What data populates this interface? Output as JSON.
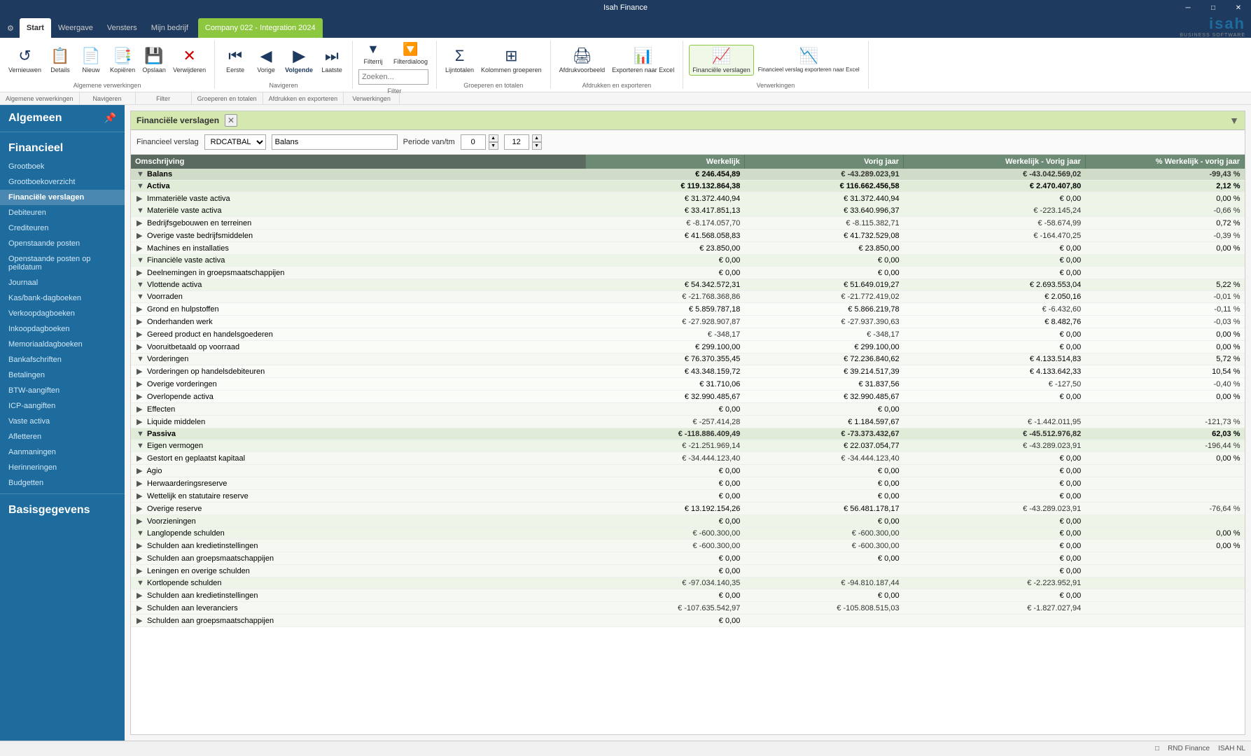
{
  "app": {
    "title": "Isah Finance",
    "window_controls": [
      "minimize",
      "maximize",
      "close"
    ]
  },
  "tabs": [
    {
      "label": "⚙",
      "id": "settings"
    },
    {
      "label": "Start",
      "id": "start",
      "active": true
    },
    {
      "label": "Weergave",
      "id": "weergave"
    },
    {
      "label": "Vensters",
      "id": "vensters"
    },
    {
      "label": "Mijn bedrijf",
      "id": "mijnbedrijf"
    },
    {
      "label": "Company 022 - Integration 2024",
      "id": "company",
      "company": true
    }
  ],
  "ribbon": {
    "groups": [
      {
        "label": "Algemene verwerkingen",
        "buttons": [
          {
            "label": "Vernieuwen",
            "icon": "↺"
          },
          {
            "label": "Details",
            "icon": "📋"
          },
          {
            "label": "Nieuw",
            "icon": "📄"
          },
          {
            "label": "Kopiëren",
            "icon": "📑"
          },
          {
            "label": "Opslaan",
            "icon": "💾"
          },
          {
            "label": "Verwijderen",
            "icon": "✕"
          }
        ]
      },
      {
        "label": "Navigeren",
        "buttons": [
          {
            "label": "Eerste",
            "icon": "⏮"
          },
          {
            "label": "Vorige",
            "icon": "◀"
          },
          {
            "label": "Volgende",
            "icon": "▶",
            "active": true
          },
          {
            "label": "Laatste",
            "icon": "⏭"
          }
        ]
      },
      {
        "label": "Filter",
        "buttons": [
          {
            "label": "Filterrij",
            "icon": "▼"
          },
          {
            "label": "Filterdialoog",
            "icon": "🔽"
          },
          {
            "label": "Zoeken...",
            "icon": "🔍",
            "search": true
          }
        ]
      },
      {
        "label": "Groeperen en totalen",
        "buttons": [
          {
            "label": "Lijntotalen",
            "icon": "Σ"
          },
          {
            "label": "Kolommen groeperen",
            "icon": "⊞"
          }
        ]
      },
      {
        "label": "Afdrukken en exporteren",
        "buttons": [
          {
            "label": "Afdrukvoorbeeld",
            "icon": "🖨"
          },
          {
            "label": "Exporteren naar Excel",
            "icon": "📊"
          }
        ]
      },
      {
        "label": "Verwerkingen",
        "buttons": [
          {
            "label": "Financiële verslagen",
            "icon": "📈",
            "active": true
          },
          {
            "label": "Financieel verslag exporteren naar Excel",
            "icon": "📉"
          }
        ]
      }
    ]
  },
  "sidebar": {
    "sections": [
      {
        "title": "Algemeen",
        "items": []
      },
      {
        "title": "Financieel",
        "items": [
          {
            "label": "Grootboek",
            "id": "grootboek"
          },
          {
            "label": "Grootboekoverzicht",
            "id": "grootboekoverzicht"
          },
          {
            "label": "Financiële verslagen",
            "id": "financiele-verslagen",
            "active": true
          },
          {
            "label": "Debiteuren",
            "id": "debiteuren"
          },
          {
            "label": "Crediteuren",
            "id": "crediteuren"
          },
          {
            "label": "Openstaande posten",
            "id": "openstaande-posten"
          },
          {
            "label": "Openstaande posten op peildatum",
            "id": "openstaande-posten-peildatum"
          },
          {
            "label": "Journaal",
            "id": "journaal"
          },
          {
            "label": "Kas/bank-dagboeken",
            "id": "kas-bank"
          },
          {
            "label": "Verkoopdagboeken",
            "id": "verkoop"
          },
          {
            "label": "Inkoopdagboeken",
            "id": "inkoop"
          },
          {
            "label": "Memoriaaldagboeken",
            "id": "memoriaal"
          },
          {
            "label": "Bankafschriften",
            "id": "bankafschriften"
          },
          {
            "label": "Betalingen",
            "id": "betalingen"
          },
          {
            "label": "BTW-aangiften",
            "id": "btw"
          },
          {
            "label": "ICP-aangiften",
            "id": "icp"
          },
          {
            "label": "Vaste activa",
            "id": "vaste-activa"
          },
          {
            "label": "Afletteren",
            "id": "afletteren"
          },
          {
            "label": "Aanmaningen",
            "id": "aanmaningen"
          },
          {
            "label": "Herinneringen",
            "id": "herinneringen"
          },
          {
            "label": "Budgetten",
            "id": "budgetten"
          }
        ]
      },
      {
        "title": "Basisgegevens",
        "items": []
      }
    ]
  },
  "report_panel": {
    "title": "Financiële verslagen",
    "toolbar": {
      "verslag_label": "Financieel verslag",
      "verslag_value": "RDCATBAL",
      "balans_value": "Balans",
      "periode_label": "Periode van/tm",
      "periode_from": "0",
      "periode_to": "12"
    },
    "table": {
      "columns": [
        "Omschrijving",
        "Werkelijk",
        "Vorig jaar",
        "Werkelijk - Vorig jaar",
        "% Werkelijk - vorig jaar"
      ],
      "rows": [
        {
          "level": 0,
          "indent": 0,
          "label": "Balans",
          "expand": true,
          "werkelijk": "€ 246.454,89",
          "vorig": "€ -43.289.023,91",
          "diff": "€ -43.042.569,02",
          "pct": "-99,43 %"
        },
        {
          "level": 1,
          "indent": 1,
          "label": "Activa",
          "expand": true,
          "werkelijk": "€ 119.132.864,38",
          "vorig": "€ 116.662.456,58",
          "diff": "€ 2.470.407,80",
          "pct": "2,12 %"
        },
        {
          "level": 2,
          "indent": 2,
          "label": "Immateriële vaste activa",
          "expand": false,
          "werkelijk": "€ 31.372.440,94",
          "vorig": "€ 31.372.440,94",
          "diff": "€ 0,00",
          "pct": "0,00 %"
        },
        {
          "level": 2,
          "indent": 2,
          "label": "Materiële vaste activa",
          "expand": true,
          "werkelijk": "€ 33.417.851,13",
          "vorig": "€ 33.640.996,37",
          "diff": "€ -223.145,24",
          "pct": "-0,66 %"
        },
        {
          "level": 3,
          "indent": 3,
          "label": "Bedrijfsgebouwen en terreinen",
          "expand": false,
          "werkelijk": "€ -8.174.057,70",
          "vorig": "€ -8.115.382,71",
          "diff": "€ -58.674,99",
          "pct": "0,72 %"
        },
        {
          "level": 3,
          "indent": 3,
          "label": "Overige vaste bedrijfsmiddelen",
          "expand": false,
          "werkelijk": "€ 41.568.058,83",
          "vorig": "€ 41.732.529,08",
          "diff": "€ -164.470,25",
          "pct": "-0,39 %"
        },
        {
          "level": 3,
          "indent": 3,
          "label": "Machines en installaties",
          "expand": false,
          "werkelijk": "€ 23.850,00",
          "vorig": "€ 23.850,00",
          "diff": "€ 0,00",
          "pct": "0,00 %"
        },
        {
          "level": 2,
          "indent": 2,
          "label": "Financiële vaste activa",
          "expand": true,
          "werkelijk": "€ 0,00",
          "vorig": "€ 0,00",
          "diff": "€ 0,00",
          "pct": ""
        },
        {
          "level": 3,
          "indent": 3,
          "label": "Deelnemingen in groepsmaatschappijen",
          "expand": false,
          "werkelijk": "€ 0,00",
          "vorig": "€ 0,00",
          "diff": "€ 0,00",
          "pct": ""
        },
        {
          "level": 2,
          "indent": 2,
          "label": "Vlottende activa",
          "expand": true,
          "werkelijk": "€ 54.342.572,31",
          "vorig": "€ 51.649.019,27",
          "diff": "€ 2.693.553,04",
          "pct": "5,22 %"
        },
        {
          "level": 3,
          "indent": 3,
          "label": "Voorraden",
          "expand": true,
          "werkelijk": "€ -21.768.368,86",
          "vorig": "€ -21.772.419,02",
          "diff": "€ 2.050,16",
          "pct": "-0,01 %"
        },
        {
          "level": 4,
          "indent": 4,
          "label": "Grond en hulpstoffen",
          "expand": false,
          "werkelijk": "€ 5.859.787,18",
          "vorig": "€ 5.866.219,78",
          "diff": "€ -6.432,60",
          "pct": "-0,11 %"
        },
        {
          "level": 4,
          "indent": 4,
          "label": "Onderhanden werk",
          "expand": false,
          "werkelijk": "€ -27.928.907,87",
          "vorig": "€ -27.937.390,63",
          "diff": "€ 8.482,76",
          "pct": "-0,03 %"
        },
        {
          "level": 4,
          "indent": 4,
          "label": "Gereed product en handelsgoederen",
          "expand": false,
          "werkelijk": "€ -348,17",
          "vorig": "€ -348,17",
          "diff": "€ 0,00",
          "pct": "0,00 %"
        },
        {
          "level": 4,
          "indent": 4,
          "label": "Vooruitbetaald op voorraad",
          "expand": false,
          "werkelijk": "€ 299.100,00",
          "vorig": "€ 299.100,00",
          "diff": "€ 0,00",
          "pct": "0,00 %"
        },
        {
          "level": 3,
          "indent": 3,
          "label": "Vorderingen",
          "expand": true,
          "werkelijk": "€ 76.370.355,45",
          "vorig": "€ 72.236.840,62",
          "diff": "€ 4.133.514,83",
          "pct": "5,72 %"
        },
        {
          "level": 4,
          "indent": 4,
          "label": "Vorderingen op handelsdebiteuren",
          "expand": false,
          "werkelijk": "€ 43.348.159,72",
          "vorig": "€ 39.214.517,39",
          "diff": "€ 4.133.642,33",
          "pct": "10,54 %"
        },
        {
          "level": 4,
          "indent": 4,
          "label": "Overige vorderingen",
          "expand": false,
          "werkelijk": "€ 31.710,06",
          "vorig": "€ 31.837,56",
          "diff": "€ -127,50",
          "pct": "-0,40 %"
        },
        {
          "level": 4,
          "indent": 4,
          "label": "Overlopende activa",
          "expand": false,
          "werkelijk": "€ 32.990.485,67",
          "vorig": "€ 32.990.485,67",
          "diff": "€ 0,00",
          "pct": "0,00 %"
        },
        {
          "level": 3,
          "indent": 3,
          "label": "Effecten",
          "expand": false,
          "werkelijk": "€ 0,00",
          "vorig": "€ 0,00",
          "diff": "",
          "pct": ""
        },
        {
          "level": 3,
          "indent": 3,
          "label": "Liquide middelen",
          "expand": false,
          "werkelijk": "€ -257.414,28",
          "vorig": "€ 1.184.597,67",
          "diff": "€ -1.442.011,95",
          "pct": "-121,73 %"
        },
        {
          "level": 1,
          "indent": 1,
          "label": "Passiva",
          "expand": true,
          "werkelijk": "€ -118.886.409,49",
          "vorig": "€ -73.373.432,67",
          "diff": "€ -45.512.976,82",
          "pct": "62,03 %"
        },
        {
          "level": 2,
          "indent": 2,
          "label": "Eigen vermogen",
          "expand": true,
          "werkelijk": "€ -21.251.969,14",
          "vorig": "€ 22.037.054,77",
          "diff": "€ -43.289.023,91",
          "pct": "-196,44 %"
        },
        {
          "level": 3,
          "indent": 3,
          "label": "Gestort en geplaatst kapitaal",
          "expand": false,
          "werkelijk": "€ -34.444.123,40",
          "vorig": "€ -34.444.123,40",
          "diff": "€ 0,00",
          "pct": "0,00 %"
        },
        {
          "level": 3,
          "indent": 3,
          "label": "Agio",
          "expand": false,
          "werkelijk": "€ 0,00",
          "vorig": "€ 0,00",
          "diff": "€ 0,00",
          "pct": ""
        },
        {
          "level": 3,
          "indent": 3,
          "label": "Herwaarderingsreserve",
          "expand": false,
          "werkelijk": "€ 0,00",
          "vorig": "€ 0,00",
          "diff": "€ 0,00",
          "pct": ""
        },
        {
          "level": 3,
          "indent": 3,
          "label": "Wettelijk en statutaire reserve",
          "expand": false,
          "werkelijk": "€ 0,00",
          "vorig": "€ 0,00",
          "diff": "€ 0,00",
          "pct": ""
        },
        {
          "level": 3,
          "indent": 3,
          "label": "Overige reserve",
          "expand": false,
          "werkelijk": "€ 13.192.154,26",
          "vorig": "€ 56.481.178,17",
          "diff": "€ -43.289.023,91",
          "pct": "-76,64 %"
        },
        {
          "level": 2,
          "indent": 2,
          "label": "Voorzieningen",
          "expand": false,
          "werkelijk": "€ 0,00",
          "vorig": "€ 0,00",
          "diff": "€ 0,00",
          "pct": ""
        },
        {
          "level": 2,
          "indent": 2,
          "label": "Langlopende schulden",
          "expand": true,
          "werkelijk": "€ -600.300,00",
          "vorig": "€ -600.300,00",
          "diff": "€ 0,00",
          "pct": "0,00 %"
        },
        {
          "level": 3,
          "indent": 3,
          "label": "Schulden aan kredietinstellingen",
          "expand": false,
          "werkelijk": "€ -600.300,00",
          "vorig": "€ -600.300,00",
          "diff": "€ 0,00",
          "pct": "0,00 %"
        },
        {
          "level": 3,
          "indent": 3,
          "label": "Schulden aan groepsmaatschappijen",
          "expand": false,
          "werkelijk": "€ 0,00",
          "vorig": "€ 0,00",
          "diff": "€ 0,00",
          "pct": ""
        },
        {
          "level": 3,
          "indent": 3,
          "label": "Leningen en overige schulden",
          "expand": false,
          "werkelijk": "€ 0,00",
          "vorig": "",
          "diff": "€ 0,00",
          "pct": ""
        },
        {
          "level": 2,
          "indent": 2,
          "label": "Kortlopende schulden",
          "expand": true,
          "werkelijk": "€ -97.034.140,35",
          "vorig": "€ -94.810.187,44",
          "diff": "€ -2.223.952,91",
          "pct": ""
        },
        {
          "level": 3,
          "indent": 3,
          "label": "Schulden aan kredietinstellingen",
          "expand": false,
          "werkelijk": "€ 0,00",
          "vorig": "€ 0,00",
          "diff": "€ 0,00",
          "pct": ""
        },
        {
          "level": 3,
          "indent": 3,
          "label": "Schulden aan leveranciers",
          "expand": false,
          "werkelijk": "€ -107.635.542,97",
          "vorig": "€ -105.808.515,03",
          "diff": "€ -1.827.027,94",
          "pct": ""
        },
        {
          "level": 3,
          "indent": 3,
          "label": "Schulden aan groepsmaatschappijen",
          "expand": false,
          "werkelijk": "€ 0,00",
          "vorig": "",
          "diff": "",
          "pct": ""
        }
      ]
    }
  },
  "status_bar": {
    "items": [
      "RND Finance",
      "ISAH NL"
    ]
  }
}
